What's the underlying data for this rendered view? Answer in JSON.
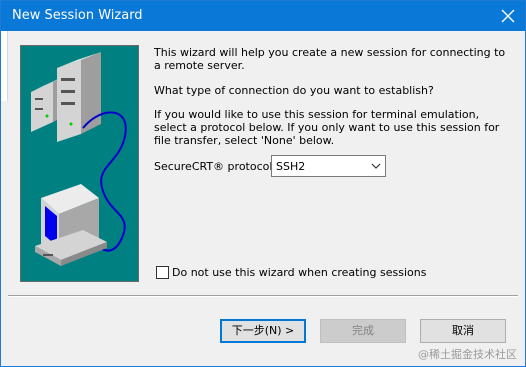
{
  "window": {
    "title": "New Session Wizard"
  },
  "body": {
    "intro": "This wizard will help you create a new session for connecting to a remote server.",
    "question": "What type of connection do you want to establish?",
    "instructions": "If you would like to use this session for terminal emulation, select a protocol below.  If you only want to use this session for file transfer, select 'None' below."
  },
  "protocol": {
    "label": "SecureCRT® protocol:",
    "selected": "SSH2"
  },
  "options": {
    "skip_wizard_label": "Do not use this wizard when creating sessions",
    "skip_wizard_checked": false
  },
  "buttons": {
    "next": "下一步(N) >",
    "finish": "完成",
    "cancel": "取消"
  },
  "watermark": "@稀土掘金技术社区",
  "colors": {
    "titlebar": "#0a78d7",
    "illustration_bg": "#008080",
    "accent": "#0078d7"
  },
  "icons": [
    "close-icon",
    "server-icon",
    "computer-icon",
    "cable-icon",
    "chevron-down-icon"
  ]
}
